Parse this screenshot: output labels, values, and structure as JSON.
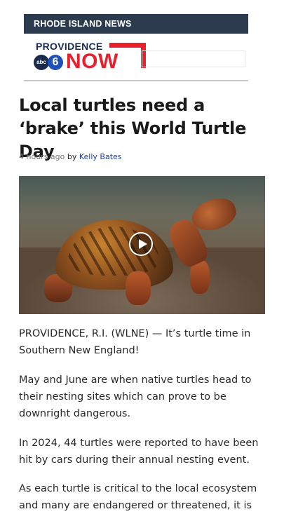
{
  "header": {
    "section_label": "RHODE ISLAND NEWS",
    "logo": {
      "top_text": "PROVIDENCE",
      "network_badge": "abc",
      "channel_number": "6",
      "brand_word": "NOW"
    }
  },
  "article": {
    "title": "Local turtles need a ‘brake’ this World Turtle Day",
    "byline": {
      "time": "4 hours ago",
      "by": "by",
      "author": "Kelly Bates"
    },
    "paragraphs": [
      "PROVIDENCE, R.I. (WLNE) — It’s turtle time in Southern New England!",
      "May and June are when native turtles head to their nesting sites which can prove to be downright dangerous.",
      "In 2024, 44 turtles were reported to have been hit by cars during their annual nesting event.",
      "As each turtle is critical to the local ecosystem and many are endangered or threatened, it is"
    ]
  },
  "icons": {
    "play": "play-icon"
  },
  "colors": {
    "section_bar": "#2b3a4d",
    "brand_red": "#e8202e",
    "author_link": "#1f3f9e"
  }
}
